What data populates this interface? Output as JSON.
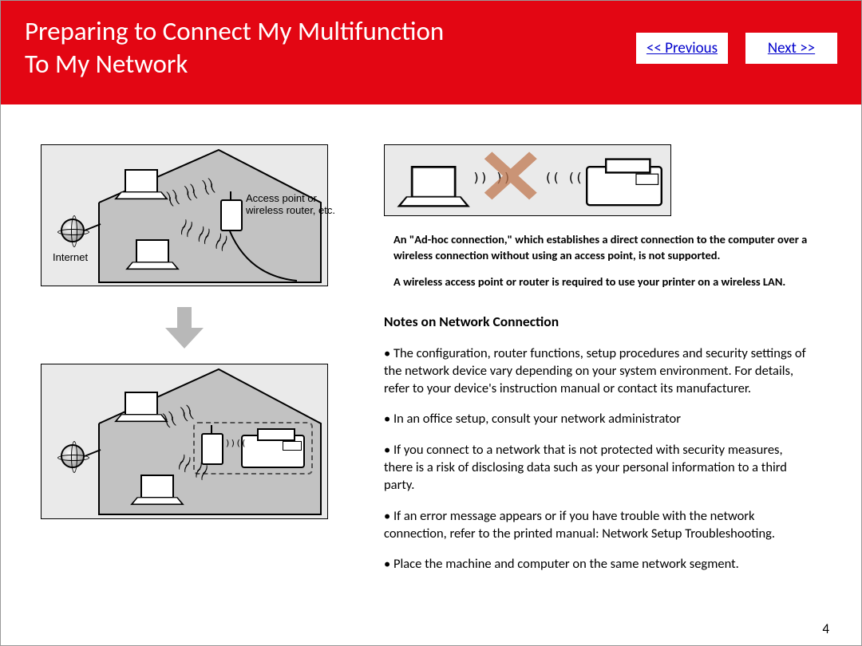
{
  "header": {
    "title_line1": "Preparing to Connect My Multifunction",
    "title_line2": "To My Network",
    "prev_label": "<< Previous",
    "next_label": "Next >>"
  },
  "left_diagram": {
    "top": {
      "internet_label": "Internet",
      "ap_label": "Access point or\nwireless router, etc."
    }
  },
  "right": {
    "adhoc_para": "An \"Ad-hoc connection,\" which establishes a direct connection to the computer over a wireless connection without using an access point, is not supported.",
    "required_para": "A wireless access point or router is required to use your printer on a wireless LAN.",
    "notes_heading": "Notes on Network Connection",
    "bullets": [
      "• The configuration, router functions, setup procedures and security settings of the network device vary depending on your system environment. For details, refer to your device's instruction manual or contact its manufacturer.",
      "• In an office setup, consult your network administrator",
      "• If you connect to a network that is not protected with security measures, there is a risk of disclosing data such as your personal information to a third party.",
      "• If an error message appears or if you have trouble with the network connection, refer to the printed manual: Network Setup Troubleshooting.",
      "• Place the machine and computer on the same network segment."
    ]
  },
  "page_number": "4"
}
